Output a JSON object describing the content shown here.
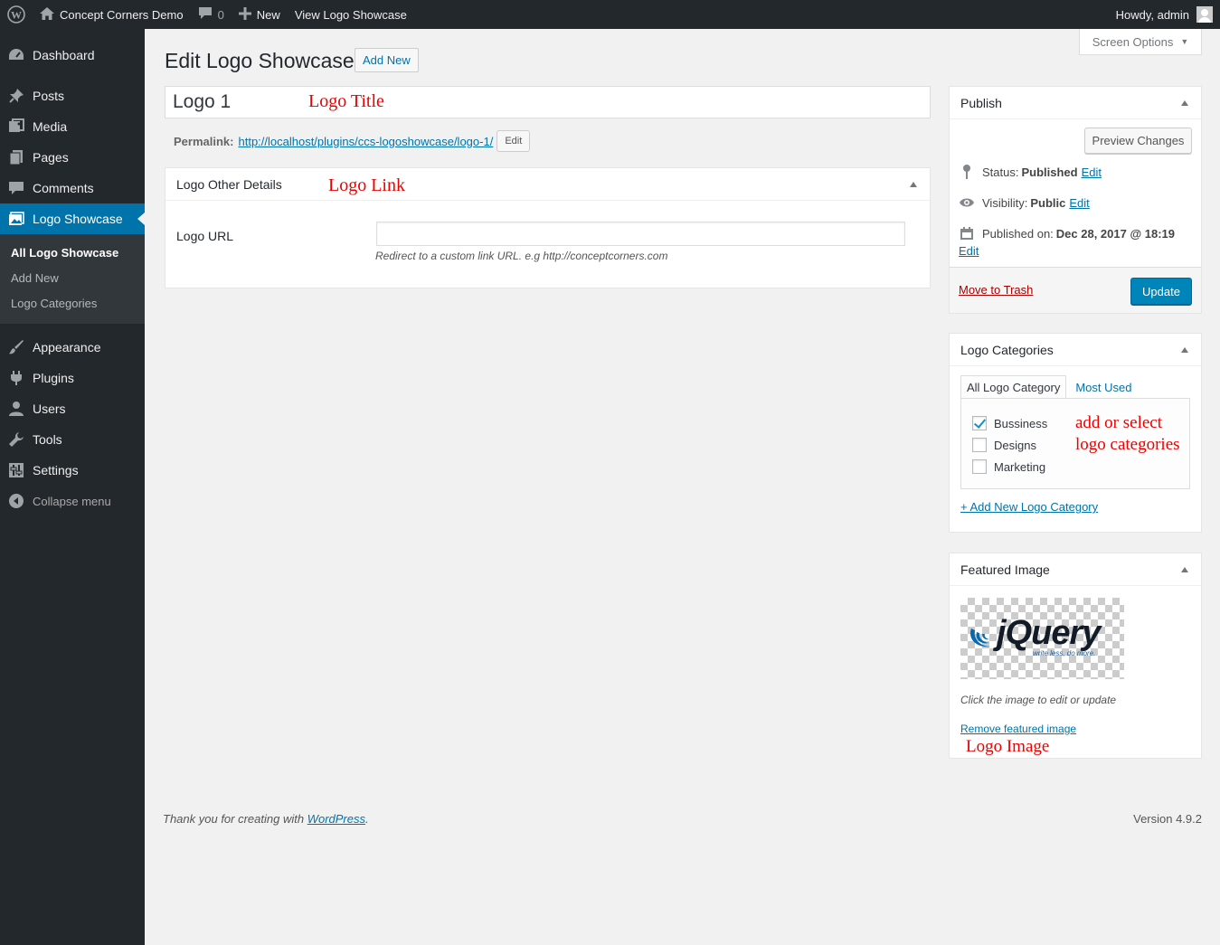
{
  "adminbar": {
    "site_name": "Concept Corners Demo",
    "comments_count": "0",
    "new_label": "New",
    "view_label": "View Logo Showcase",
    "howdy": "Howdy, admin"
  },
  "sidebar": {
    "items": [
      {
        "label": "Dashboard",
        "icon": "dashboard-icon"
      },
      {
        "label": "Posts",
        "icon": "pin-icon"
      },
      {
        "label": "Media",
        "icon": "media-icon"
      },
      {
        "label": "Pages",
        "icon": "pages-icon"
      },
      {
        "label": "Comments",
        "icon": "comment-icon"
      },
      {
        "label": "Logo Showcase",
        "icon": "images-icon"
      }
    ],
    "submenu": [
      "All Logo Showcase",
      "Add New",
      "Logo Categories"
    ],
    "items2": [
      {
        "label": "Appearance",
        "icon": "brush-icon"
      },
      {
        "label": "Plugins",
        "icon": "plugin-icon"
      },
      {
        "label": "Users",
        "icon": "users-icon"
      },
      {
        "label": "Tools",
        "icon": "wrench-icon"
      },
      {
        "label": "Settings",
        "icon": "settings-icon"
      }
    ],
    "collapse": "Collapse menu"
  },
  "screen_options": "Screen Options",
  "page": {
    "title": "Edit Logo Showcase",
    "add_new": "Add New",
    "post_title": "Logo 1",
    "annotation_title": "Logo Title",
    "permalink_label": "Permalink:",
    "permalink_url": "http://localhost/plugins/ccs-logoshowcase/logo-1/",
    "edit_btn": "Edit"
  },
  "details_box": {
    "title": "Logo Other Details",
    "annotation": "Logo Link",
    "url_label": "Logo URL",
    "url_value": "",
    "description": "Redirect to a custom link URL. e.g http://conceptcorners.com"
  },
  "publish": {
    "title": "Publish",
    "preview": "Preview Changes",
    "status_label": "Status:",
    "status_value": "Published",
    "visibility_label": "Visibility:",
    "visibility_value": "Public",
    "published_label": "Published on:",
    "published_value": "Dec 28, 2017 @ 18:19",
    "edit": "Edit",
    "trash": "Move to Trash",
    "update": "Update"
  },
  "categories": {
    "title": "Logo Categories",
    "tab_all": "All Logo Category",
    "tab_used": "Most Used",
    "items": [
      {
        "label": "Bussiness",
        "checked": true
      },
      {
        "label": "Designs",
        "checked": false
      },
      {
        "label": "Marketing",
        "checked": false
      }
    ],
    "annotation_line1": "add or select",
    "annotation_line2": "logo categories",
    "add_new": "+ Add New Logo Category"
  },
  "featured": {
    "title": "Featured Image",
    "logo_text": "jQuery",
    "logo_tagline": "write less, do more.",
    "hint": "Click the image to edit or update",
    "remove": "Remove featured image",
    "annotation": "Logo Image"
  },
  "footer": {
    "thanks_prefix": "Thank you for creating with ",
    "wordpress": "WordPress",
    "thanks_suffix": ".",
    "version": "Version 4.9.2"
  },
  "colors": {
    "admin_dark": "#23282d",
    "accent": "#0073aa",
    "annotation_red": "#e00000"
  }
}
